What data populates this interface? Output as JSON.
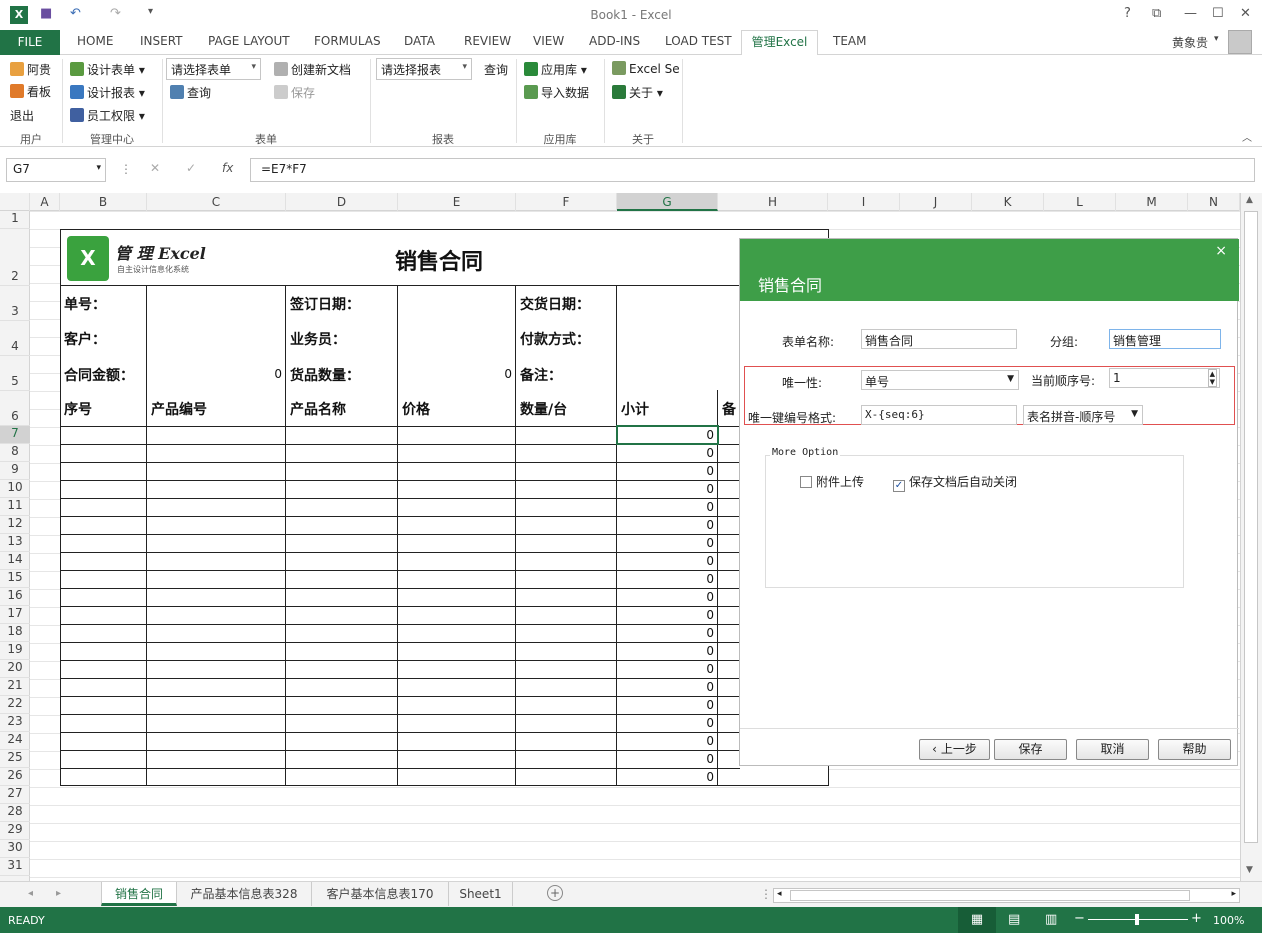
{
  "window": {
    "title": "Book1 - Excel"
  },
  "tabs": [
    "HOME",
    "INSERT",
    "PAGE LAYOUT",
    "FORMULAS",
    "DATA",
    "REVIEW",
    "VIEW",
    "ADD-INS",
    "LOAD TEST",
    "管理Excel",
    "TEAM"
  ],
  "file_tab": "FILE",
  "user": "黄象贵",
  "ribbon": {
    "user_group": {
      "label": "用户",
      "items": [
        "阿贵",
        "看板",
        "退出"
      ]
    },
    "mgmt_group": {
      "label": "管理中心",
      "items": [
        "设计表单",
        "设计报表",
        "员工权限"
      ]
    },
    "form_group": {
      "label": "表单",
      "combo": "请选择表单",
      "query": "查询",
      "new_doc": "创建新文档",
      "save": "保存"
    },
    "report_group": {
      "label": "报表",
      "combo": "请选择报表",
      "query": "查询"
    },
    "lib_group": {
      "label": "应用库",
      "items": [
        "应用库",
        "导入数据"
      ]
    },
    "about_group": {
      "label": "关于",
      "items": [
        "Excel Se",
        "关于"
      ]
    }
  },
  "formula_bar": {
    "name_box": "G7",
    "formula": "=E7*F7",
    "fx": "fx"
  },
  "columns": [
    "A",
    "B",
    "C",
    "D",
    "E",
    "F",
    "G",
    "H",
    "I",
    "J",
    "K",
    "L",
    "M",
    "N"
  ],
  "rows": [
    "1",
    "2",
    "3",
    "4",
    "5",
    "6",
    "7",
    "8",
    "9",
    "10",
    "11",
    "12",
    "13",
    "14",
    "15",
    "16",
    "17",
    "18",
    "19",
    "20",
    "21",
    "22",
    "23",
    "24",
    "25",
    "26",
    "27",
    "28",
    "29",
    "30",
    "31"
  ],
  "sheet": {
    "logo_text": "管 理 Excel",
    "logo_sub": "自主设计信息化系统",
    "title": "销售合同",
    "labels": {
      "order_no": "单号：",
      "sign_date": "签订日期：",
      "delivery_date": "交货日期：",
      "customer": "客户：",
      "salesman": "业务员：",
      "payment": "付款方式：",
      "amount": "合同金额：",
      "qty": "货品数量：",
      "remark": "备注："
    },
    "amount_value": "0",
    "qty_value": "0",
    "headers": [
      "序号",
      "产品编号",
      "产品名称",
      "价格",
      "数量/台",
      "小计",
      "备"
    ],
    "subtotals": [
      "0",
      "0",
      "0",
      "0",
      "0",
      "0",
      "0",
      "0",
      "0",
      "0",
      "0",
      "0",
      "0",
      "0",
      "0",
      "0",
      "0",
      "0",
      "0",
      "0"
    ]
  },
  "dialog": {
    "title": "销售合同",
    "close": "×",
    "form_name_label": "表单名称:",
    "form_name_value": "销售合同",
    "group_label": "分组:",
    "group_value": "销售管理",
    "unique_label": "唯一性:",
    "unique_value": "单号",
    "seq_label": "当前顺序号:",
    "seq_value": "1",
    "format_label": "唯一键编号格式:",
    "format_value": "X-{seq:6}",
    "format_option": "表名拼音-顺序号",
    "more_option": "More Option",
    "attach_label": "附件上传",
    "autoclose_label": "保存文档后自动关闭",
    "buttons": {
      "prev": "上一步",
      "save": "保存",
      "cancel": "取消",
      "help": "帮助"
    }
  },
  "sheet_tabs": [
    "销售合同",
    "产品基本信息表328",
    "客户基本信息表170",
    "Sheet1"
  ],
  "status": {
    "ready": "READY",
    "zoom": "100%"
  },
  "colors": {
    "excel_green": "#217346",
    "dialog_green": "#3e9e48"
  }
}
